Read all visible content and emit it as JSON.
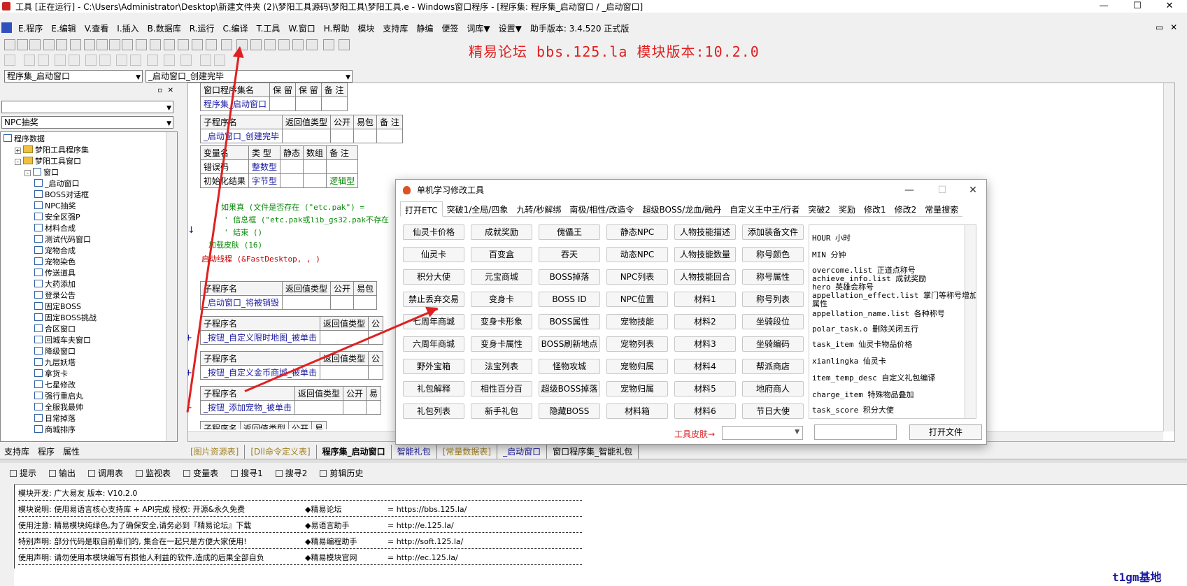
{
  "window": {
    "title": "工具 [正在运行] - C:\\Users\\Administrator\\Desktop\\新建文件夹 (2)\\梦阳工具源码\\梦阳工具\\梦阳工具.e - Windows窗口程序 - [程序集: 程序集_启动窗口 / _启动窗口]",
    "min": "—",
    "max": "☐",
    "close": "✕"
  },
  "menu": [
    "E.程序",
    "E.编辑",
    "V.查看",
    "I.插入",
    "B.数据库",
    "R.运行",
    "C.编译",
    "T.工具",
    "W.窗口",
    "H.帮助",
    "模块",
    "支持库",
    "静编",
    "便签",
    "词库▼",
    "设置▼",
    "助手版本: 3.4.520 正式版"
  ],
  "forum_banner": "精易论坛 bbs.125.la 模块版本:10.2.0",
  "combos": {
    "assembly": "程序集_启动窗口",
    "sub": "_启动窗口_创建完毕",
    "left_search": "",
    "left_filter": "NPC抽奖"
  },
  "tree": {
    "root": "程序数据",
    "nodes": [
      {
        "label": "梦阳工具程序集",
        "type": "folder",
        "level": 1,
        "exp": "+"
      },
      {
        "label": "梦阳工具窗口",
        "type": "folder",
        "level": 1,
        "exp": "-"
      },
      {
        "label": "窗口",
        "type": "item",
        "level": 2,
        "exp": "-"
      },
      {
        "label": "_启动窗口",
        "type": "item",
        "level": 3
      },
      {
        "label": "BOSS对话框",
        "type": "item",
        "level": 3
      },
      {
        "label": "NPC抽奖",
        "type": "item",
        "level": 3
      },
      {
        "label": "安全区强P",
        "type": "item",
        "level": 3
      },
      {
        "label": "材料合成",
        "type": "item",
        "level": 3
      },
      {
        "label": "测试代码窗口",
        "type": "item",
        "level": 3
      },
      {
        "label": "宠物合成",
        "type": "item",
        "level": 3
      },
      {
        "label": "宠物染色",
        "type": "item",
        "level": 3
      },
      {
        "label": "传送道具",
        "type": "item",
        "level": 3
      },
      {
        "label": "大药添加",
        "type": "item",
        "level": 3
      },
      {
        "label": "登录公告",
        "type": "item",
        "level": 3
      },
      {
        "label": "固定BOSS",
        "type": "item",
        "level": 3
      },
      {
        "label": "固定BOSS挑战",
        "type": "item",
        "level": 3
      },
      {
        "label": "合区窗口",
        "type": "item",
        "level": 3
      },
      {
        "label": "回城车夫窗口",
        "type": "item",
        "level": 3
      },
      {
        "label": "降级窗口",
        "type": "item",
        "level": 3
      },
      {
        "label": "九层妖塔",
        "type": "item",
        "level": 3
      },
      {
        "label": "拿货卡",
        "type": "item",
        "level": 3
      },
      {
        "label": "七星修改",
        "type": "item",
        "level": 3
      },
      {
        "label": "强行重启丸",
        "type": "item",
        "level": 3
      },
      {
        "label": "全服我最帅",
        "type": "item",
        "level": 3
      },
      {
        "label": "日常掉落",
        "type": "item",
        "level": 3
      },
      {
        "label": "商城排序",
        "type": "item",
        "level": 3
      }
    ]
  },
  "left_tabs": [
    "支持库",
    "程序",
    "属性"
  ],
  "code": {
    "t1": {
      "h": [
        "窗口程序集名",
        "保 留",
        "保 留",
        "备 注"
      ],
      "r": [
        "程序集_启动窗口",
        "",
        "",
        ""
      ]
    },
    "t2": {
      "h": [
        "子程序名",
        "返回值类型",
        "公开",
        "易包",
        "备 注"
      ],
      "r": [
        "_启动窗口_创建完毕",
        "",
        "",
        "",
        ""
      ]
    },
    "t3": {
      "h": [
        "变量名",
        "类 型",
        "静态",
        "数组",
        "备 注"
      ],
      "rows": [
        [
          "错误码",
          "整数型",
          "",
          "",
          ""
        ],
        [
          "初始化结果",
          "字节型",
          "",
          "",
          "逻辑型"
        ]
      ]
    },
    "lines": [
      "如果真 (文件是否存在 (\"etc.pak\") =",
      "' 信息框 (\"etc.pak或lib_gs32.pak不存在",
      "' 结束 ()",
      "加载皮肤 (16)",
      "启动线程 (&FastDesktop, , )"
    ],
    "subs": [
      {
        "h": [
          "子程序名",
          "返回值类型",
          "公开",
          "易包"
        ],
        "name": "_启动窗口_将被销毁"
      },
      {
        "h": [
          "子程序名",
          "返回值类型",
          "公"
        ],
        "name": "_按钮_自定义限时地图_被单击"
      },
      {
        "h": [
          "子程序名",
          "返回值类型",
          "公"
        ],
        "name": "_按钮_自定义金币商城_被单击"
      },
      {
        "h": [
          "子程序名",
          "返回值类型",
          "公开",
          "易"
        ],
        "name": "_按钮_添加宠物_被单击"
      },
      {
        "h": [
          "子程序名",
          "返回值类型",
          "公开",
          "易"
        ],
        "name": ""
      }
    ]
  },
  "doc_tabs": [
    "[图片资源表]",
    "[Dll命令定义表]",
    "程序集_启动窗口",
    "智能礼包",
    "[常量数据表]",
    "_启动窗口",
    "窗口程序集_智能礼包"
  ],
  "bottom_tabs": [
    "提示",
    "输出",
    "调用表",
    "监视表",
    "变量表",
    "搜寻1",
    "搜寻2",
    "剪辑历史"
  ],
  "output_lines": [
    {
      "a": "模块开发: 广大易友    版本: V10.2.0",
      "b": "",
      "c": ""
    },
    {
      "a": "模块说明: 使用易语言核心支持库 + API完成     授权: 开源&永久免费",
      "b": "◆精易论坛",
      "c": "= https://bbs.125.la/"
    },
    {
      "a": "使用注意: 精易模块纯绿色,为了确保安全,请务必到『精易论坛』下载",
      "b": "◆易语言助手",
      "c": "= http://e.125.la/"
    },
    {
      "a": "特别声明: 部分代码是取自前辈们的, 集合在一起只是方便大家使用!",
      "b": "◆精易编程助手",
      "c": "= http://soft.125.la/"
    },
    {
      "a": "使用声明: 请勿使用本模块编写有损他人利益的软件,造成的后果全部自负",
      "b": "◆精易模块官网",
      "c": "= http://ec.125.la/"
    }
  ],
  "dialog": {
    "title": "单机学习修改工具",
    "min": "—",
    "max": "☐",
    "close": "✕",
    "tabs": [
      "打开ETC",
      "突破1/全局/四象",
      "九转/秒解绑",
      "南极/相性/改造令",
      "超级BOSS/龙血/融丹",
      "自定义王中王/行者",
      "突破2",
      "奖励",
      "修改1",
      "修改2",
      "常量搜索"
    ],
    "buttons": [
      [
        "仙灵卡价格",
        "成就奖励",
        "傀儡王",
        "静态NPC",
        "人物技能描述",
        "添加装备文件"
      ],
      [
        "仙灵卡",
        "百变盒",
        "吞天",
        "动态NPC",
        "人物技能数量",
        "称号颜色"
      ],
      [
        "积分大使",
        "元宝商城",
        "BOSS掉落",
        "NPC列表",
        "人物技能回合",
        "称号属性"
      ],
      [
        "禁止丢弃交易",
        "变身卡",
        "BOSS ID",
        "NPC位置",
        "材料1",
        "称号列表"
      ],
      [
        "七周年商城",
        "变身卡形象",
        "BOSS属性",
        "宠物技能",
        "材料2",
        "坐骑段位"
      ],
      [
        "六周年商城",
        "变身卡属性",
        "BOSS刷新地点",
        "宠物列表",
        "材料3",
        "坐骑编码"
      ],
      [
        "野外宝箱",
        "法宝列表",
        "怪物攻城",
        "宠物归属",
        "材料4",
        "帮派商店"
      ],
      [
        "礼包解释",
        "相性百分百",
        "超级BOSS掉落",
        "宠物归属",
        "材料5",
        "地府商人"
      ],
      [
        "礼包列表",
        "新手礼包",
        "隐藏BOSS",
        "材料箱",
        "材料6",
        "节日大使"
      ]
    ],
    "info": [
      "HOUR 小时",
      "MIN  分钟",
      "overcome.list 正道点称号",
      "achieve_info.list 成就奖励",
      "hero  英雄会称号",
      "appellation_effect.list 掌门等称号增加",
      "属性",
      "appellation_name.list   各种称号",
      "polar_task.o   删除关闭五行",
      "task_item  仙灵卡物品价格",
      "xianlingka  仙灵卡",
      "item_temp_desc    自定义礼包编译",
      "charge_item    特殊物品叠加",
      "task_score 积分大使"
    ],
    "skin_label": "工具皮肤→",
    "skin_value": "",
    "path_value": "",
    "open_file": "打开文件"
  },
  "watermark": "t1gm基地"
}
